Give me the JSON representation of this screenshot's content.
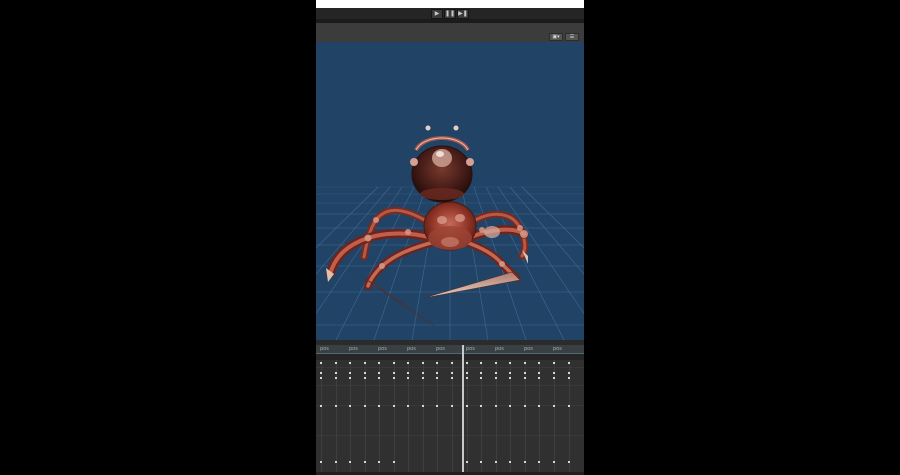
{
  "playback": {
    "play_icon": "▶",
    "pause_icon": "❚❚",
    "step_icon": "▶❚"
  },
  "scene_toolbar": {
    "gizmo_label": "▣▾",
    "menu_label": "☰"
  },
  "viewport": {
    "background": "#214366",
    "grid_color": "#4a78a6",
    "model": "spider-creature"
  },
  "timeline": {
    "ticks": [
      "pos",
      "pos",
      "pos",
      "pos",
      "pos",
      "pos",
      "pos",
      "pos",
      "pos"
    ],
    "accent": "#4f6a73"
  }
}
